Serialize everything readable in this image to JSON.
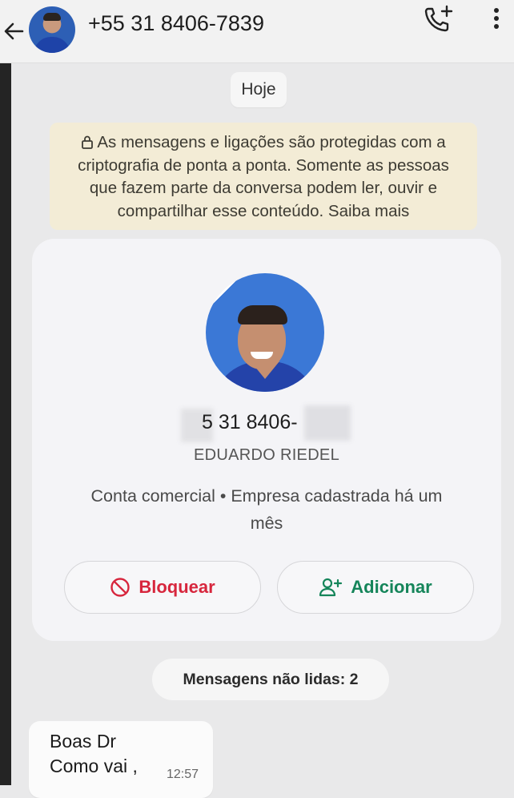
{
  "header": {
    "contact_title": "+55 31 8406-7839",
    "back_icon": "arrow-left-icon",
    "call_icon": "add-call-icon",
    "menu_icon": "more-vertical-icon"
  },
  "chat": {
    "date_chip": "Hoje",
    "e2e_notice": {
      "lines": [
        "As mensagens e ligações são protegidas com a",
        "criptografia de ponta a ponta. Somente as pessoas",
        "que fazem parte da conversa podem ler, ouvir e",
        "compartilhar esse conteúdo. Saiba mais"
      ],
      "icon": "lock-icon"
    },
    "profile_card": {
      "phone_partial": "5 31 8406-",
      "name": "EDUARDO RIEDEL",
      "account_info_line1": "Conta comercial • Empresa cadastrada há um",
      "account_info_line2": "mês",
      "block_label": "Bloquear",
      "block_icon": "block-icon",
      "add_label": "Adicionar",
      "add_icon": "add-person-icon"
    },
    "unread_chip": "Mensagens não lidas: 2",
    "message": {
      "line1": "Boas Dr",
      "line2": "Como vai ,",
      "time": "12:57"
    }
  },
  "colors": {
    "danger": "#d7263d",
    "accent_green": "#15855a",
    "notice_bg": "#f3ecd6"
  }
}
